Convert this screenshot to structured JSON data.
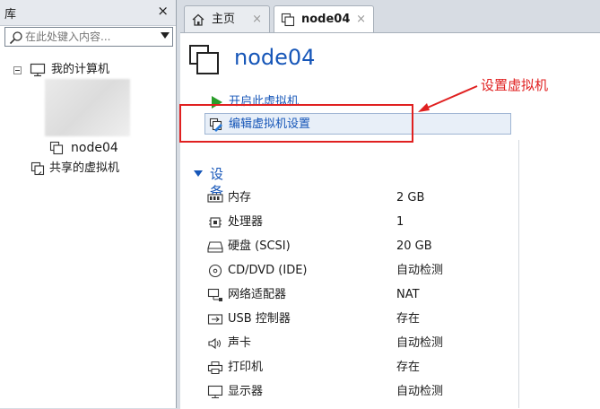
{
  "library": {
    "title": "库",
    "close": "×",
    "search_placeholder": "在此处键入内容...",
    "tree": {
      "root_label": "我的计算机",
      "vm_label": "node04",
      "shared_label": "共享的虚拟机"
    }
  },
  "tabs": [
    {
      "label": "主页",
      "icon": "home-icon",
      "close": "×"
    },
    {
      "label": "node04",
      "icon": "vm-icon",
      "close": "×"
    }
  ],
  "vm": {
    "title": "node04",
    "commands": {
      "power_on": "开启此虚拟机",
      "edit_settings": "编辑虚拟机设置"
    }
  },
  "annotation": {
    "label": "设置虚拟机",
    "color": "#e02020"
  },
  "devices": {
    "section_label": "设备",
    "items": [
      {
        "name": "内存",
        "value": "2 GB",
        "icon": "memory-icon"
      },
      {
        "name": "处理器",
        "value": "1",
        "icon": "cpu-icon"
      },
      {
        "name": "硬盘 (SCSI)",
        "value": "20 GB",
        "icon": "hard-disk-icon"
      },
      {
        "name": "CD/DVD (IDE)",
        "value": "自动检测",
        "icon": "cd-dvd-icon"
      },
      {
        "name": "网络适配器",
        "value": "NAT",
        "icon": "network-adapter-icon"
      },
      {
        "name": "USB 控制器",
        "value": "存在",
        "icon": "usb-icon"
      },
      {
        "name": "声卡",
        "value": "自动检测",
        "icon": "sound-card-icon"
      },
      {
        "name": "打印机",
        "value": "存在",
        "icon": "printer-icon"
      },
      {
        "name": "显示器",
        "value": "自动检测",
        "icon": "display-icon"
      }
    ]
  },
  "colors": {
    "accent": "#1656b8",
    "annotation": "#e02020",
    "power_green": "#2a9d2a"
  }
}
